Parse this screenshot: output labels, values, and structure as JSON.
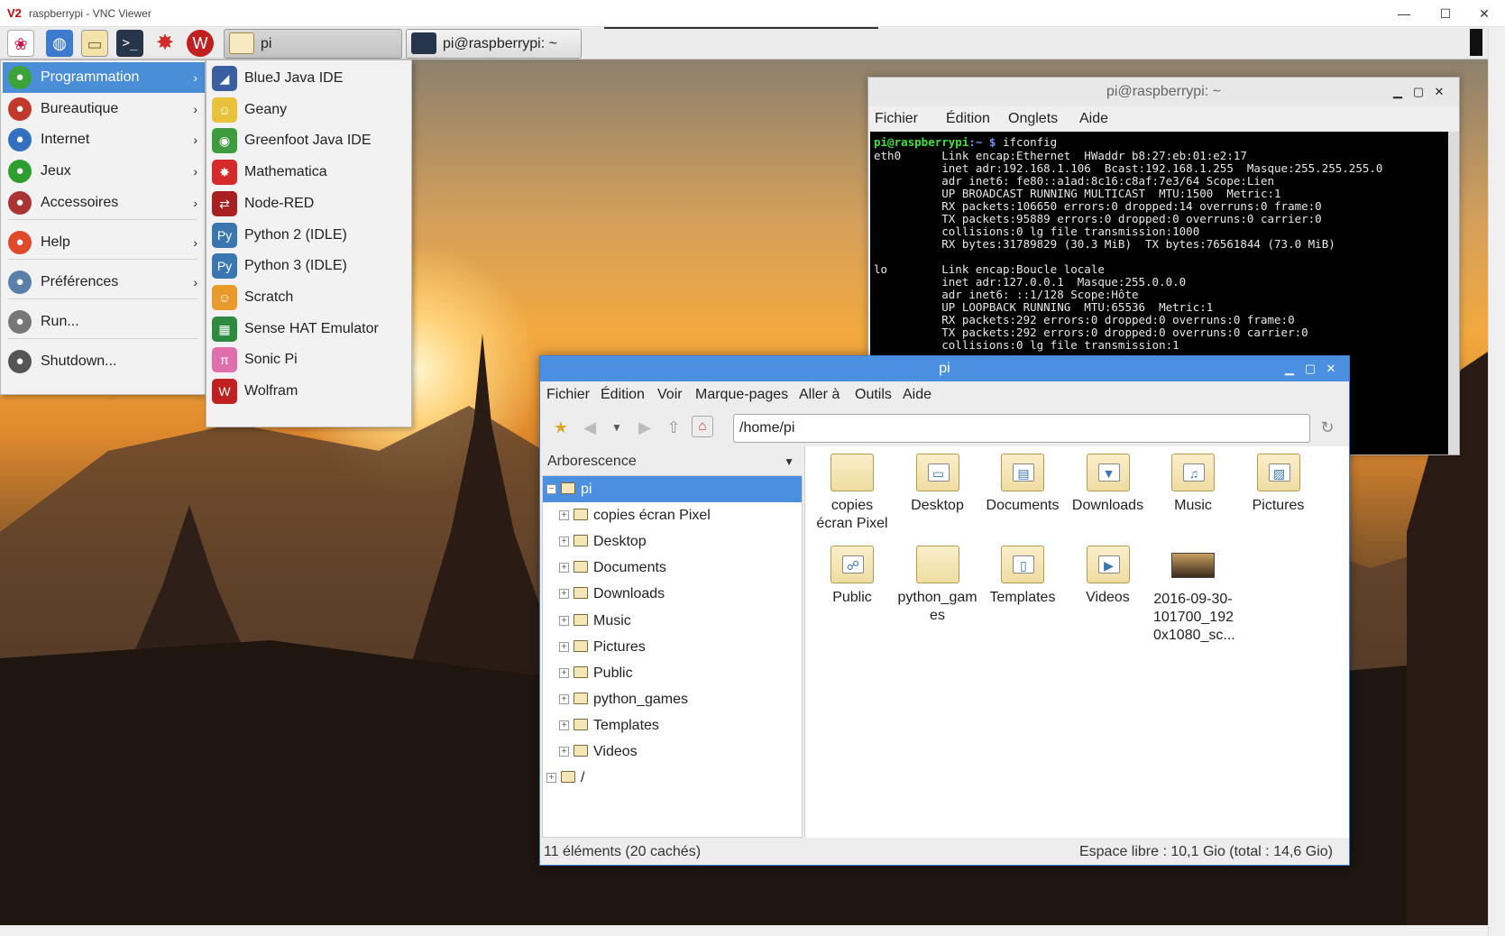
{
  "vnc": {
    "title": "raspberrypi - VNC Viewer",
    "logo": "V2",
    "minimize": "—",
    "maximize": "☐",
    "close": "✕"
  },
  "taskbar": {
    "launchers": [
      "raspberry-icon",
      "globe-icon",
      "folder-icon",
      "terminal-icon",
      "mathematica-icon",
      "wolfram-icon"
    ],
    "tasks": [
      {
        "label": "pi"
      },
      {
        "label": "pi@raspberrypi: ~"
      }
    ]
  },
  "menu": {
    "items": [
      {
        "label": "Programmation",
        "icon": "code-icon",
        "color": "#3aa33a",
        "arrow": "›"
      },
      {
        "label": "Bureautique",
        "icon": "office-icon",
        "color": "#c0392b",
        "arrow": "›"
      },
      {
        "label": "Internet",
        "icon": "globe-icon",
        "color": "#3470c0",
        "arrow": "›"
      },
      {
        "label": "Jeux",
        "icon": "game-icon",
        "color": "#2e9e2e",
        "arrow": "›"
      },
      {
        "label": "Accessoires",
        "icon": "tools-icon",
        "color": "#a33",
        "arrow": "›"
      },
      {
        "label": "Help",
        "icon": "lifebuoy-icon",
        "color": "#e04a2a",
        "arrow": "›"
      },
      {
        "label": "Préférences",
        "icon": "preferences-icon",
        "color": "#5a7fa8",
        "arrow": "›"
      },
      {
        "label": "Run...",
        "icon": "run-icon",
        "color": "#777"
      },
      {
        "label": "Shutdown...",
        "icon": "power-icon",
        "color": "#555"
      }
    ]
  },
  "submenu": {
    "items": [
      {
        "label": "BlueJ Java IDE",
        "icon": "bluej-icon",
        "color": "#3a5fa0",
        "glyph": "◢"
      },
      {
        "label": "Geany",
        "icon": "geany-icon",
        "color": "#e8c23a",
        "glyph": "☺"
      },
      {
        "label": "Greenfoot Java IDE",
        "icon": "greenfoot-icon",
        "color": "#3f9b3f",
        "glyph": "◉"
      },
      {
        "label": "Mathematica",
        "icon": "mathematica-icon",
        "color": "#d42a2a",
        "glyph": "✸"
      },
      {
        "label": "Node-RED",
        "icon": "nodered-icon",
        "color": "#a82020",
        "glyph": "⇄"
      },
      {
        "label": "Python 2 (IDLE)",
        "icon": "python-icon",
        "color": "#3a76b0",
        "glyph": "Py"
      },
      {
        "label": "Python 3 (IDLE)",
        "icon": "python-icon",
        "color": "#3a76b0",
        "glyph": "Py"
      },
      {
        "label": "Scratch",
        "icon": "scratch-icon",
        "color": "#e89a2a",
        "glyph": "☺"
      },
      {
        "label": "Sense HAT Emulator",
        "icon": "sensehat-icon",
        "color": "#2e8a3e",
        "glyph": "▦"
      },
      {
        "label": "Sonic Pi",
        "icon": "sonicpi-icon",
        "color": "#e06fae",
        "glyph": "π"
      },
      {
        "label": "Wolfram",
        "icon": "wolfram-icon",
        "color": "#c02020",
        "glyph": "W"
      }
    ]
  },
  "terminal": {
    "title": "pi@raspberrypi: ~",
    "menu": [
      "Fichier",
      "Édition",
      "Onglets",
      "Aide"
    ],
    "prompt_user": "pi@raspberrypi",
    "prompt_path": ":~ $",
    "command": " ifconfig",
    "lines": [
      "eth0      Link encap:Ethernet  HWaddr b8:27:eb:01:e2:17",
      "          inet adr:192.168.1.106  Bcast:192.168.1.255  Masque:255.255.255.0",
      "          adr inet6: fe80::a1ad:8c16:c8af:7e3/64 Scope:Lien",
      "          UP BROADCAST RUNNING MULTICAST  MTU:1500  Metric:1",
      "          RX packets:106650 errors:0 dropped:14 overruns:0 frame:0",
      "          TX packets:95889 errors:0 dropped:0 overruns:0 carrier:0",
      "          collisions:0 lg file transmission:1000",
      "          RX bytes:31789829 (30.3 MiB)  TX bytes:76561844 (73.0 MiB)",
      "",
      "lo        Link encap:Boucle locale",
      "          inet adr:127.0.0.1  Masque:255.0.0.0",
      "          adr inet6: ::1/128 Scope:Hôte",
      "          UP LOOPBACK RUNNING  MTU:65536  Metric:1",
      "          RX packets:292 errors:0 dropped:0 overruns:0 frame:0",
      "          TX packets:292 errors:0 dropped:0 overruns:0 carrier:0",
      "          collisions:0 lg file transmission:1"
    ]
  },
  "filemanager": {
    "title": "pi",
    "menu": [
      "Fichier",
      "Édition",
      "Voir",
      "Marque-pages",
      "Aller à",
      "Outils",
      "Aide"
    ],
    "address": "/home/pi",
    "tree_header": "Arborescence",
    "tree": [
      {
        "label": "pi",
        "level": 0,
        "expander": "−",
        "selected": true
      },
      {
        "label": "copies écran Pixel",
        "level": 1,
        "expander": "+"
      },
      {
        "label": "Desktop",
        "level": 1,
        "expander": "+"
      },
      {
        "label": "Documents",
        "level": 1,
        "expander": "+"
      },
      {
        "label": "Downloads",
        "level": 1,
        "expander": "+"
      },
      {
        "label": "Music",
        "level": 1,
        "expander": "+"
      },
      {
        "label": "Pictures",
        "level": 1,
        "expander": "+"
      },
      {
        "label": "Public",
        "level": 1,
        "expander": "+"
      },
      {
        "label": "python_games",
        "level": 1,
        "expander": "+"
      },
      {
        "label": "Templates",
        "level": 1,
        "expander": "+"
      },
      {
        "label": "Videos",
        "level": 1,
        "expander": "+"
      },
      {
        "label": "/",
        "level": 0,
        "expander": "+"
      }
    ],
    "files": [
      {
        "label": "copies\nécran Pixel",
        "icon": "folder-icon",
        "emb": ""
      },
      {
        "label": "Desktop",
        "icon": "desktop-folder-icon",
        "emb": "▭"
      },
      {
        "label": "Documents",
        "icon": "documents-folder-icon",
        "emb": "▤"
      },
      {
        "label": "Downloads",
        "icon": "downloads-folder-icon",
        "emb": "▼"
      },
      {
        "label": "Music",
        "icon": "music-folder-icon",
        "emb": "♫"
      },
      {
        "label": "Pictures",
        "icon": "pictures-folder-icon",
        "emb": "▨"
      },
      {
        "label": "Public",
        "icon": "public-folder-icon",
        "emb": "☍"
      },
      {
        "label": "python_gam\nes",
        "icon": "folder-icon",
        "emb": ""
      },
      {
        "label": "Templates",
        "icon": "templates-folder-icon",
        "emb": "▯"
      },
      {
        "label": "Videos",
        "icon": "videos-folder-icon",
        "emb": "▶"
      },
      {
        "label": "2016-09-30-\n101700_192\n0x1080_sc...",
        "icon": "image-thumbnail-icon",
        "emb": "",
        "thumb": true
      }
    ],
    "status_left": "11 éléments (20 cachés)",
    "status_right": "Espace libre : 10,1 Gio (total : 14,6 Gio)"
  }
}
